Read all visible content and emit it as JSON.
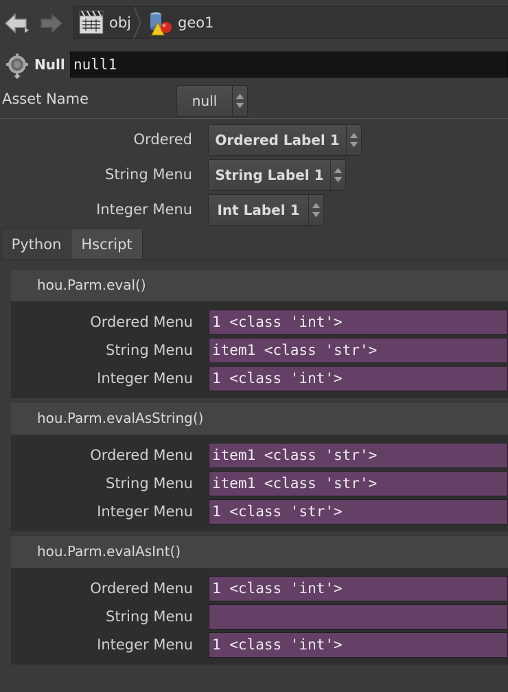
{
  "nav": {
    "back_icon": "back-arrow-icon",
    "forward_icon": "forward-arrow-icon",
    "breadcrumb": [
      {
        "label": "obj",
        "icon": "obj-network-icon"
      },
      {
        "label": "geo1",
        "icon": "geo-node-icon"
      }
    ]
  },
  "node": {
    "type_label": "Null",
    "name": "null1",
    "icon": "gear-icon"
  },
  "asset": {
    "label": "Asset Name",
    "value": "null"
  },
  "params": [
    {
      "label": "Ordered",
      "value": "Ordered Label 1"
    },
    {
      "label": "String Menu",
      "value": "String Label 1"
    },
    {
      "label": "Integer Menu",
      "value": "Int Label 1"
    }
  ],
  "tabs": [
    {
      "label": "Python",
      "active": true
    },
    {
      "label": "Hscript",
      "active": false
    }
  ],
  "folders": [
    {
      "title": "hou.Parm.eval()",
      "rows": [
        {
          "label": "Ordered Menu",
          "value": "1 <class 'int'>"
        },
        {
          "label": "String Menu",
          "value": "item1 <class 'str'>"
        },
        {
          "label": "Integer Menu",
          "value": "1 <class 'int'>"
        }
      ]
    },
    {
      "title": "hou.Parm.evalAsString()",
      "rows": [
        {
          "label": "Ordered Menu",
          "value": "item1 <class 'str'>"
        },
        {
          "label": "String Menu",
          "value": "item1 <class 'str'>"
        },
        {
          "label": "Integer Menu",
          "value": "1 <class 'str'>"
        }
      ]
    },
    {
      "title": "hou.Parm.evalAsInt()",
      "rows": [
        {
          "label": "Ordered Menu",
          "value": "1 <class 'int'>"
        },
        {
          "label": "String Menu",
          "value": ""
        },
        {
          "label": "Integer Menu",
          "value": "1 <class 'int'>"
        }
      ]
    }
  ],
  "colors": {
    "background": "#3a3a3a",
    "field_expression": "#643f66",
    "name_field": "#141414"
  }
}
